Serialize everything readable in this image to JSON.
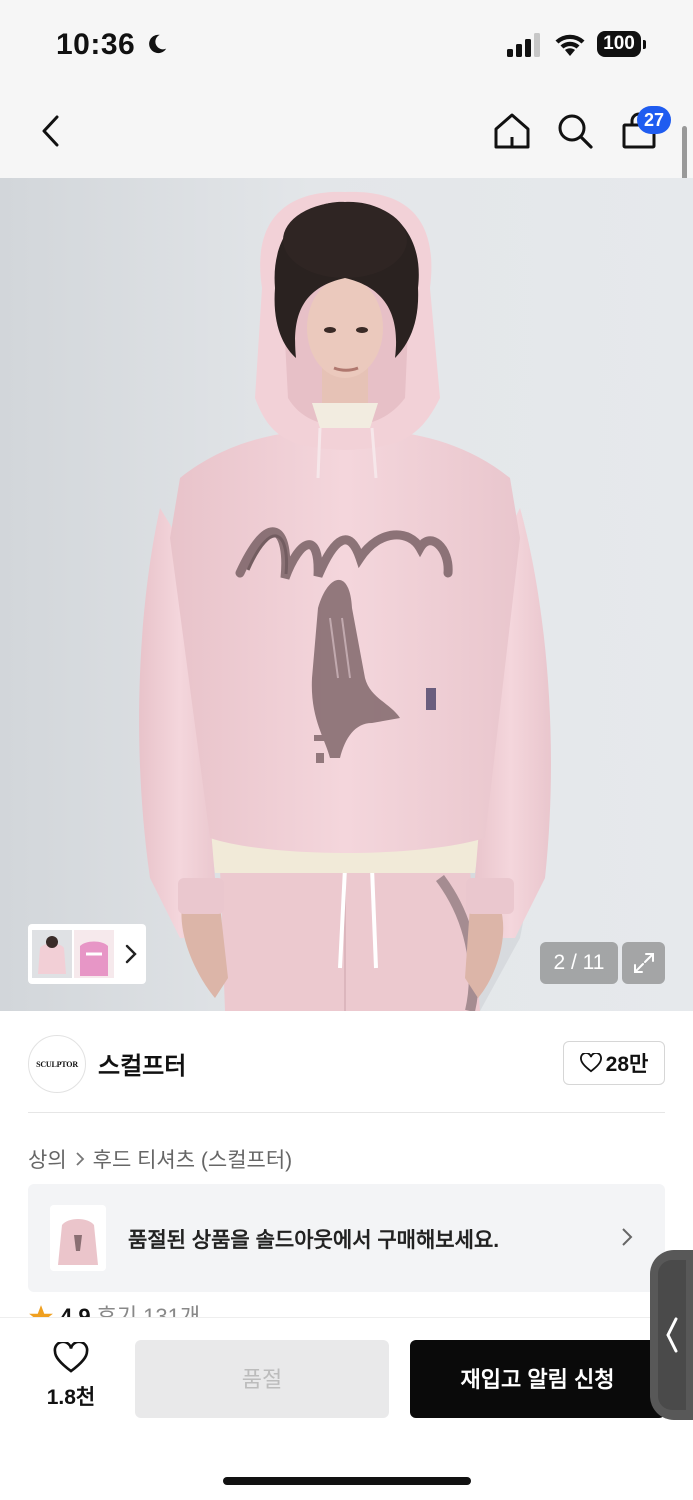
{
  "status_bar": {
    "time": "10:36",
    "battery": "100"
  },
  "nav": {
    "cart_count": "27"
  },
  "gallery": {
    "counter": "2 / 11"
  },
  "brand": {
    "logo_text": "SCULPTOR",
    "name": "스컬프터",
    "likes": "28만"
  },
  "breadcrumb": {
    "level1": "상의",
    "level2": "후드 티셔츠 (스컬프터)"
  },
  "soldout_banner": {
    "text": "품절된 상품을 솔드아웃에서 구매해보세요."
  },
  "review": {
    "rating": "4.9",
    "count_label": "후기 131개"
  },
  "bottom_bar": {
    "wishlist_count": "1.8천",
    "soldout_label": "품절",
    "restock_label": "재입고 알림 신청"
  },
  "colors": {
    "accent": "#1f5cf0",
    "hoodie": "#f2d3d9",
    "cta": "#0a0a0a"
  }
}
